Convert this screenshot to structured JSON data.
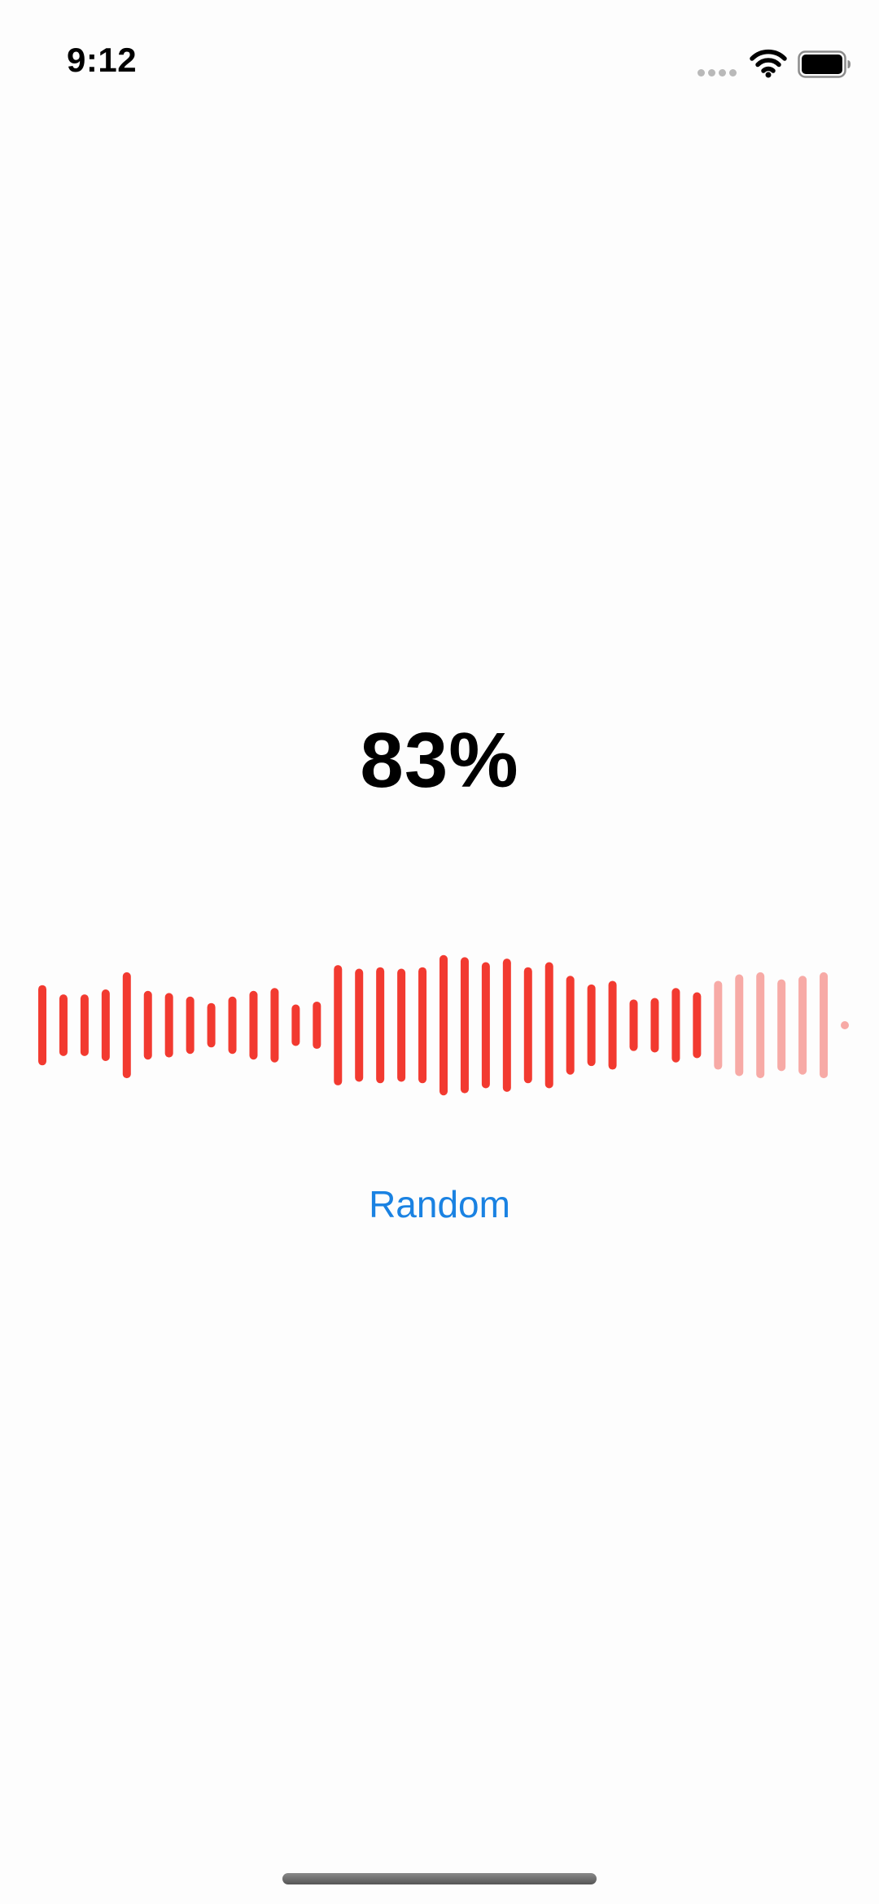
{
  "status_bar": {
    "time": "9:12"
  },
  "main": {
    "percent_label": "83%",
    "random_button_label": "Random"
  },
  "waveform": {
    "bar_count": 39,
    "progress": 0.83,
    "active_color": "#f23a30",
    "inactive_color": "#f7aaa6",
    "amplitudes": [
      0.56,
      0.43,
      0.43,
      0.5,
      0.74,
      0.48,
      0.45,
      0.4,
      0.31,
      0.4,
      0.48,
      0.52,
      0.29,
      0.33,
      0.84,
      0.79,
      0.81,
      0.79,
      0.81,
      0.98,
      0.95,
      0.88,
      0.93,
      0.81,
      0.88,
      0.69,
      0.57,
      0.62,
      0.36,
      0.38,
      0.52,
      0.46,
      0.62,
      0.71,
      0.74,
      0.64,
      0.69,
      0.74,
      0.05
    ]
  },
  "icons": {
    "cellular": "cellular-signal-icon",
    "wifi": "wifi-icon",
    "battery": "battery-icon"
  }
}
